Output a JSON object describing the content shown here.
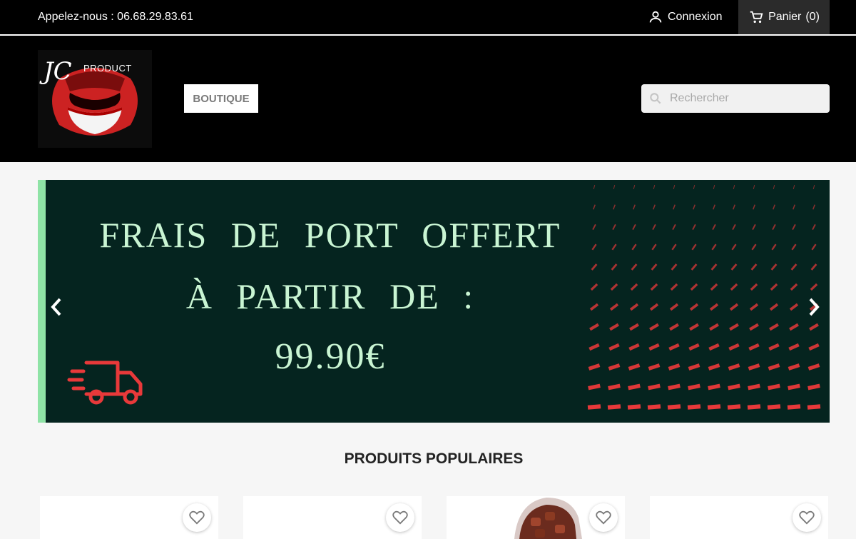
{
  "topbar": {
    "phone_text": "Appelez-nous : 06.68.29.83.61",
    "login_label": "Connexion",
    "cart_label": "Panier",
    "cart_count": "(0)"
  },
  "header": {
    "logo_initials": "JC",
    "logo_text": "PRODUCT",
    "nav_items": [
      {
        "label": "BOUTIQUE"
      }
    ],
    "search": {
      "placeholder": "Rechercher",
      "value": ""
    }
  },
  "banner": {
    "line1": "FRAIS DE PORT OFFERT",
    "line2": "À PARTIR DE :",
    "line3": "99.90€"
  },
  "products_section": {
    "title": "PRODUITS POPULAIRES",
    "cards": [
      {
        "wishlist_icon": "heart-outline-icon"
      },
      {
        "wishlist_icon": "heart-outline-icon"
      },
      {
        "wishlist_icon": "heart-outline-icon"
      },
      {
        "wishlist_icon": "heart-outline-icon"
      }
    ]
  },
  "colors": {
    "topbar_bg": "#000000",
    "banner_bg": "#05241f",
    "banner_text": "#c9f5d3",
    "accent_red": "#e8393a",
    "page_bg": "#f6f6f6"
  }
}
